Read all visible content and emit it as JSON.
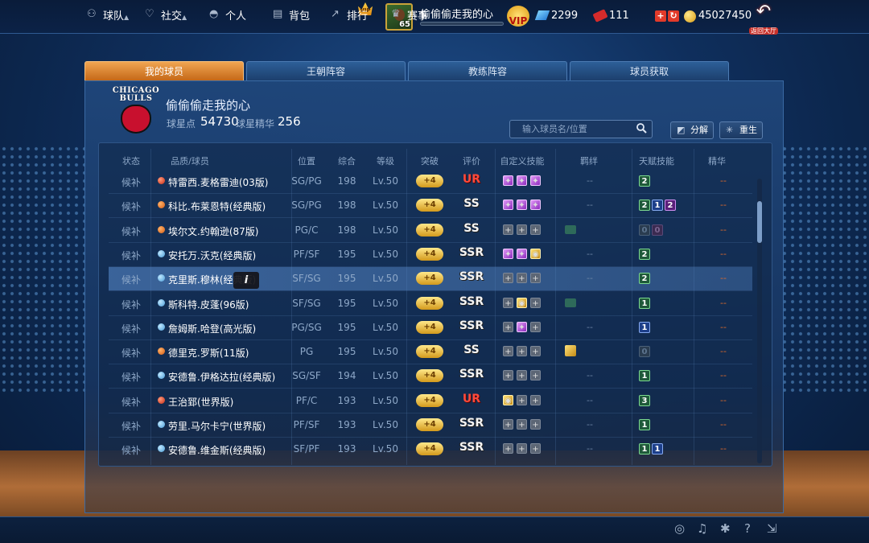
{
  "top": {
    "vip_badge": "VIP",
    "player_name": "偷偷偷走我的心",
    "player_level": "65",
    "vip_label": "VIP",
    "gems": "2299",
    "tickets": "111",
    "coins": "45027450",
    "back_label": "返回大厅",
    "colors": {
      "accent": "#e08a10",
      "tab_active": "#c56817"
    }
  },
  "tabs": [
    {
      "label": "我的球员",
      "active": true
    },
    {
      "label": "王朝阵容",
      "active": false
    },
    {
      "label": "教练阵容",
      "active": false
    },
    {
      "label": "球员获取",
      "active": false
    }
  ],
  "team": {
    "logo_text_1": "CHICAGO",
    "logo_text_2": "BULLS",
    "name": "偷偷偷走我的心",
    "points_label": "球星点",
    "points": "54730",
    "essence_label": "球星精华",
    "essence": "256"
  },
  "search": {
    "placeholder": "输入球员名/位置"
  },
  "buttons": {
    "decompose": "分解",
    "rebirth": "重生"
  },
  "columns": [
    "状态",
    "品质/球员",
    "位置",
    "综合",
    "等级",
    "突破",
    "评价",
    "自定义技能",
    "羁绊",
    "天赋技能",
    "精华"
  ],
  "rows": [
    {
      "status": "候补",
      "dot": "red",
      "name": "特雷西.麦格雷迪(03版)",
      "pos": "SG/PG",
      "ovr": "198",
      "lvl": "Lv.50",
      "brk": "+4",
      "grade": "UR",
      "skills": [
        "purple",
        "purple",
        "purple"
      ],
      "bond": "--",
      "bond_icon": "",
      "talents": [
        {
          "v": "2",
          "c": "green"
        }
      ],
      "essence": "--"
    },
    {
      "status": "候补",
      "dot": "orange",
      "name": "科比.布莱恩特(经典版)",
      "pos": "SG/PG",
      "ovr": "198",
      "lvl": "Lv.50",
      "brk": "+4",
      "grade": "SS",
      "skills": [
        "purple",
        "purple",
        "purple"
      ],
      "bond": "--",
      "bond_icon": "",
      "talents": [
        {
          "v": "2",
          "c": "green"
        },
        {
          "v": "1",
          "c": "blue"
        },
        {
          "v": "2",
          "c": "purple"
        }
      ],
      "essence": "--"
    },
    {
      "status": "候补",
      "dot": "orange",
      "name": "埃尔文.约翰逊(87版)",
      "pos": "PG/C",
      "ovr": "198",
      "lvl": "Lv.50",
      "brk": "+4",
      "grade": "SS",
      "skills": [
        "empty",
        "empty",
        "empty"
      ],
      "bond": "",
      "bond_icon": "teal",
      "talents": [
        {
          "v": "0",
          "c": "dim"
        },
        {
          "v": "0",
          "c": "dimp"
        }
      ],
      "essence": "--"
    },
    {
      "status": "候补",
      "dot": "blue",
      "name": "安托万.沃克(经典版)",
      "pos": "PF/SF",
      "ovr": "195",
      "lvl": "Lv.50",
      "brk": "+4",
      "grade": "SSR",
      "skills": [
        "purple",
        "purple",
        "gold"
      ],
      "bond": "--",
      "bond_icon": "",
      "talents": [
        {
          "v": "2",
          "c": "green"
        }
      ],
      "essence": "--"
    },
    {
      "status": "候补",
      "dot": "blue",
      "name": "克里斯.穆林(经典版)",
      "pos": "SF/SG",
      "ovr": "195",
      "lvl": "Lv.50",
      "brk": "+4",
      "grade": "SSR",
      "skills": [
        "empty",
        "empty",
        "empty"
      ],
      "bond": "--",
      "bond_icon": "",
      "talents": [
        {
          "v": "2",
          "c": "green"
        }
      ],
      "essence": "--",
      "selected": true
    },
    {
      "status": "候补",
      "dot": "blue",
      "name": "斯科特.皮蓬(96版)",
      "pos": "SF/SG",
      "ovr": "195",
      "lvl": "Lv.50",
      "brk": "+4",
      "grade": "SSR",
      "skills": [
        "empty",
        "gold",
        "empty"
      ],
      "bond": "",
      "bond_icon": "teal",
      "talents": [
        {
          "v": "1",
          "c": "green"
        }
      ],
      "essence": "--"
    },
    {
      "status": "候补",
      "dot": "blue",
      "name": "詹姆斯.哈登(高光版)",
      "pos": "PG/SG",
      "ovr": "195",
      "lvl": "Lv.50",
      "brk": "+4",
      "grade": "SSR",
      "skills": [
        "empty",
        "purple",
        "empty"
      ],
      "bond": "--",
      "bond_icon": "",
      "talents": [
        {
          "v": "1",
          "c": "blue"
        }
      ],
      "essence": "--"
    },
    {
      "status": "候补",
      "dot": "orange",
      "name": "德里克.罗斯(11版)",
      "pos": "PG",
      "ovr": "195",
      "lvl": "Lv.50",
      "brk": "+4",
      "grade": "SS",
      "skills": [
        "empty",
        "empty",
        "empty"
      ],
      "bond": "",
      "bond_icon": "gold",
      "talents": [
        {
          "v": "0",
          "c": "dim"
        }
      ],
      "essence": "--"
    },
    {
      "status": "候补",
      "dot": "blue",
      "name": "安德鲁.伊格达拉(经典版)",
      "pos": "SG/SF",
      "ovr": "194",
      "lvl": "Lv.50",
      "brk": "+4",
      "grade": "SSR",
      "skills": [
        "empty",
        "empty",
        "empty"
      ],
      "bond": "--",
      "bond_icon": "",
      "talents": [
        {
          "v": "1",
          "c": "green"
        }
      ],
      "essence": "--"
    },
    {
      "status": "候补",
      "dot": "red",
      "name": "王治郅(世界版)",
      "pos": "PF/C",
      "ovr": "193",
      "lvl": "Lv.50",
      "brk": "+4",
      "grade": "UR",
      "skills": [
        "gold",
        "empty",
        "empty"
      ],
      "bond": "--",
      "bond_icon": "",
      "talents": [
        {
          "v": "3",
          "c": "green"
        }
      ],
      "essence": "--"
    },
    {
      "status": "候补",
      "dot": "blue",
      "name": "劳里.马尔卡宁(世界版)",
      "pos": "PF/SF",
      "ovr": "193",
      "lvl": "Lv.50",
      "brk": "+4",
      "grade": "SSR",
      "skills": [
        "empty",
        "empty",
        "empty"
      ],
      "bond": "--",
      "bond_icon": "",
      "talents": [
        {
          "v": "1",
          "c": "green"
        }
      ],
      "essence": "--"
    },
    {
      "status": "候补",
      "dot": "blue",
      "name": "安德鲁.维金斯(经典版)",
      "pos": "SF/PF",
      "ovr": "193",
      "lvl": "Lv.50",
      "brk": "+4",
      "grade": "SSR",
      "skills": [
        "empty",
        "empty",
        "empty"
      ],
      "bond": "--",
      "bond_icon": "",
      "talents": [
        {
          "v": "1",
          "c": "green"
        },
        {
          "v": "1",
          "c": "blue"
        }
      ],
      "essence": "--"
    }
  ],
  "tooltip": "i",
  "bottom_nav": [
    {
      "label": "球队",
      "icon": "person-icon",
      "caret": true
    },
    {
      "label": "社交",
      "icon": "heart-icon",
      "caret": true
    },
    {
      "label": "个人",
      "icon": "user-icon",
      "caret": false
    },
    {
      "label": "背包",
      "icon": "bag-icon",
      "caret": false
    },
    {
      "label": "排行",
      "icon": "ranking-icon",
      "caret": false
    },
    {
      "label": "赛事",
      "icon": "trophy-icon",
      "caret": false
    }
  ]
}
